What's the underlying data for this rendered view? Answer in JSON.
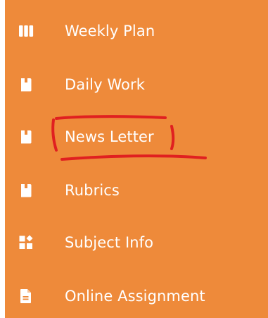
{
  "sidebar": {
    "background_color": "#ee8a3a",
    "text_color": "#ffffff",
    "items": [
      {
        "label": "Weekly Plan",
        "icon": "columns-icon"
      },
      {
        "label": "Daily Work",
        "icon": "book-icon"
      },
      {
        "label": "News Letter",
        "icon": "book-icon",
        "highlighted": true
      },
      {
        "label": "Rubrics",
        "icon": "book-icon"
      },
      {
        "label": "Subject Info",
        "icon": "shapes-icon"
      },
      {
        "label": "Online Assignment",
        "icon": "file-text-icon"
      }
    ]
  },
  "annotation": {
    "color": "#e02020",
    "target": "News Letter"
  }
}
